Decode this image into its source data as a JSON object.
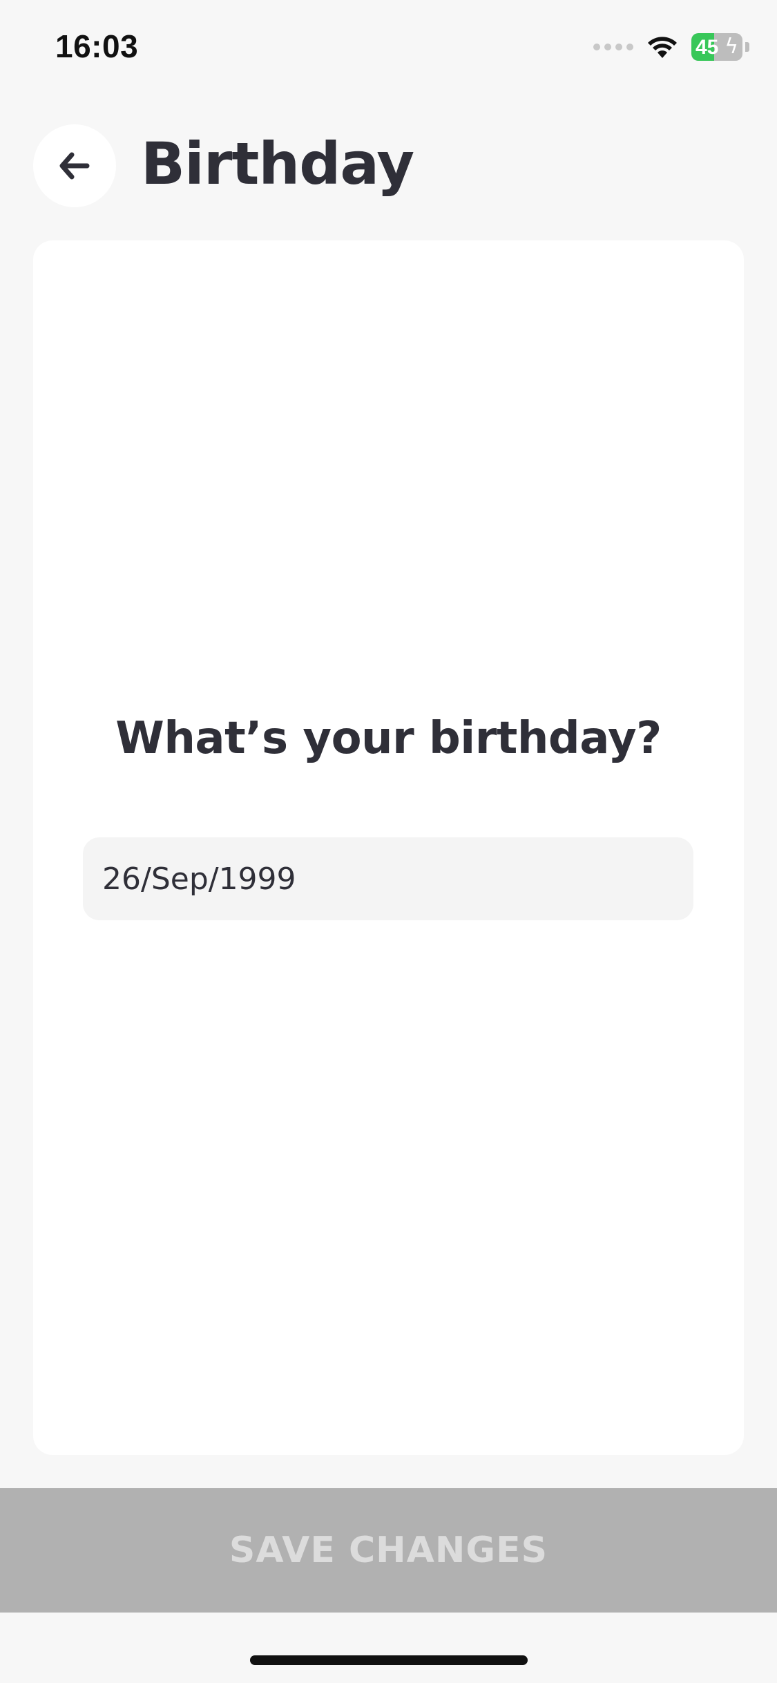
{
  "status_bar": {
    "time": "16:03",
    "battery_level": "45",
    "battery_fraction": 0.45,
    "battery_charging_icon": "bolt-icon",
    "wifi_icon": "wifi-icon",
    "signal_icon": "cellular-signal-icon"
  },
  "header": {
    "title": "Birthday",
    "back_icon": "arrow-left-icon"
  },
  "card": {
    "question": "What’s your birthday?",
    "date_value": "26/Sep/1999"
  },
  "footer": {
    "save_label": "SAVE CHANGES"
  },
  "colors": {
    "background": "#f7f7f7",
    "card": "#ffffff",
    "text": "#2f2f38",
    "field": "#f4f4f4",
    "save_button_disabled": "#b1b1b1",
    "save_label_disabled": "#dcdcdc",
    "battery_green": "#38c759"
  }
}
